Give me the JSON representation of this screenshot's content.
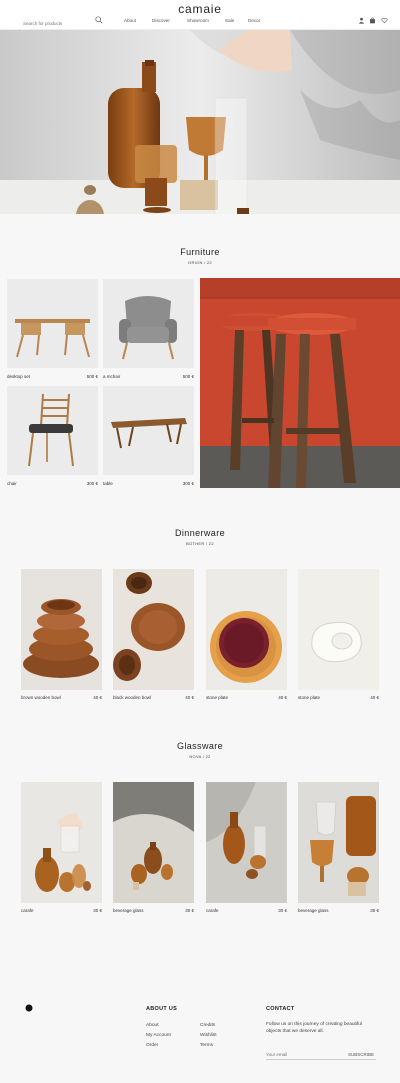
{
  "header": {
    "search_placeholder": "Search for products",
    "logo": "camaie",
    "nav": [
      "About",
      "Discover",
      "Showroom",
      "Sale",
      "Decor"
    ],
    "icons": [
      "user-icon",
      "cart-icon",
      "heart-icon"
    ]
  },
  "furniture": {
    "title": "Furniture",
    "subtitle": "ORION / 22",
    "products": [
      {
        "name": "desktop set",
        "price": "500 €"
      },
      {
        "name": "a mchair",
        "price": "500 €"
      },
      {
        "name": "chair",
        "price": "300 €"
      },
      {
        "name": "table",
        "price": "300 €"
      }
    ]
  },
  "dinnerware": {
    "title": "Dinnerware",
    "subtitle": "BOTHER / 22",
    "products": [
      {
        "name": "brown wooden bowl",
        "price": "40 €"
      },
      {
        "name": "black wooden bowl",
        "price": "40 €"
      },
      {
        "name": "stone plate",
        "price": "40 €"
      },
      {
        "name": "stone plate",
        "price": "40 €"
      }
    ]
  },
  "glassware": {
    "title": "Glassware",
    "subtitle": "NOVA / 22",
    "products": [
      {
        "name": "carafe",
        "price": "30 €"
      },
      {
        "name": "beverage glass",
        "price": "30 €"
      },
      {
        "name": "carafe",
        "price": "30 €"
      },
      {
        "name": "beverage glass",
        "price": "30 €"
      }
    ]
  },
  "footer": {
    "about_title": "ABOUT US",
    "links_col1": [
      "About",
      "My Account",
      "Order"
    ],
    "links_col2": [
      "Credits",
      "Wishlist",
      "Terms"
    ],
    "contact_title": "CONTACT",
    "contact_text_1": "Follow us on this journey of creating beautiful",
    "contact_text_2": "objects that we deserve all.",
    "email_placeholder": "Your email",
    "subscribe_label": "SUBSCRIBE"
  },
  "colors": {
    "background": "#f7f7f7",
    "amber": "#b06a25",
    "stool_red": "#c8472e"
  }
}
